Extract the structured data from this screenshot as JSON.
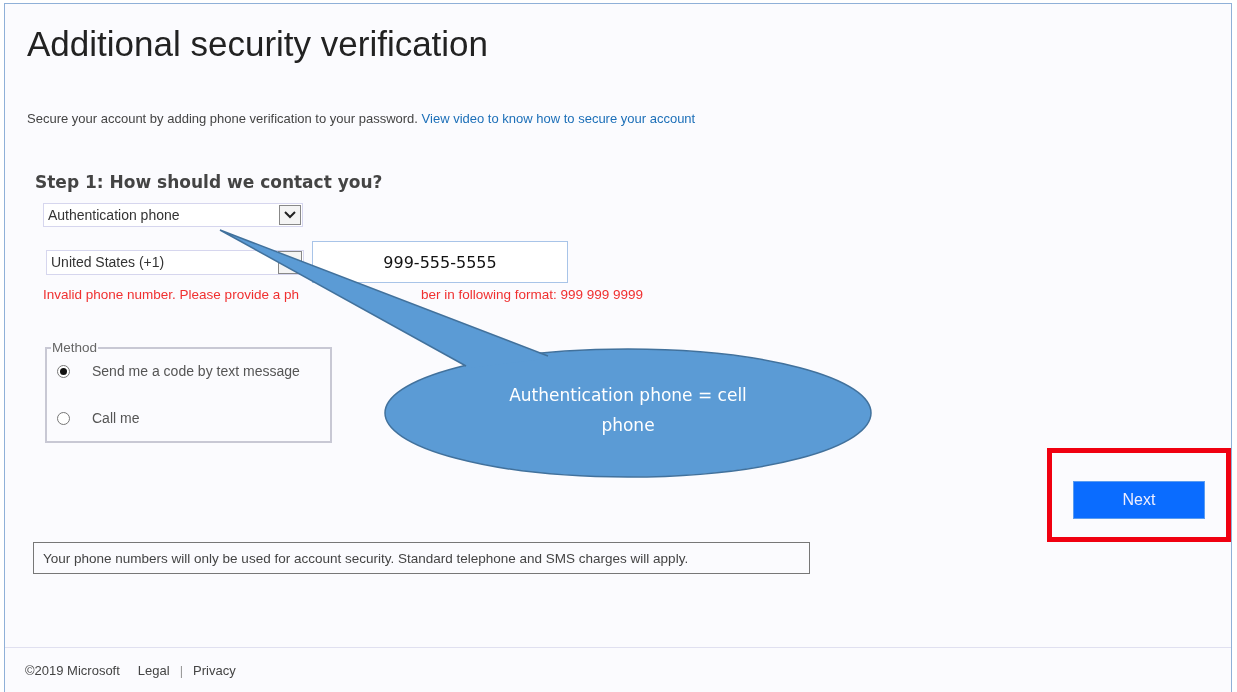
{
  "page": {
    "title": "Additional security verification",
    "intro": "Secure your account by adding phone verification to your password.",
    "intro_link": "View video to know how to secure your account"
  },
  "step": {
    "heading": "Step 1: How should we contact you?",
    "contact_select": "Authentication phone",
    "country_select": "United States (+1)",
    "phone": "999-555-5555",
    "error_parts": [
      "Invalid phone number. Please provide a ph",
      "ber in following format: 999 999 9999"
    ]
  },
  "method": {
    "legend": "Method",
    "options": [
      {
        "label": "Send me a code by text message",
        "selected": true
      },
      {
        "label": "Call me",
        "selected": false
      }
    ]
  },
  "next_button": {
    "label": "Next",
    "highlighted": true
  },
  "notice": "Your phone numbers will only be used for account security. Standard telephone and SMS charges will apply.",
  "footer": {
    "copyright": "©2019 Microsoft",
    "links": [
      "Legal",
      "Privacy"
    ],
    "separator": "|"
  },
  "callout": {
    "text": "Authentication phone = cell phone"
  }
}
